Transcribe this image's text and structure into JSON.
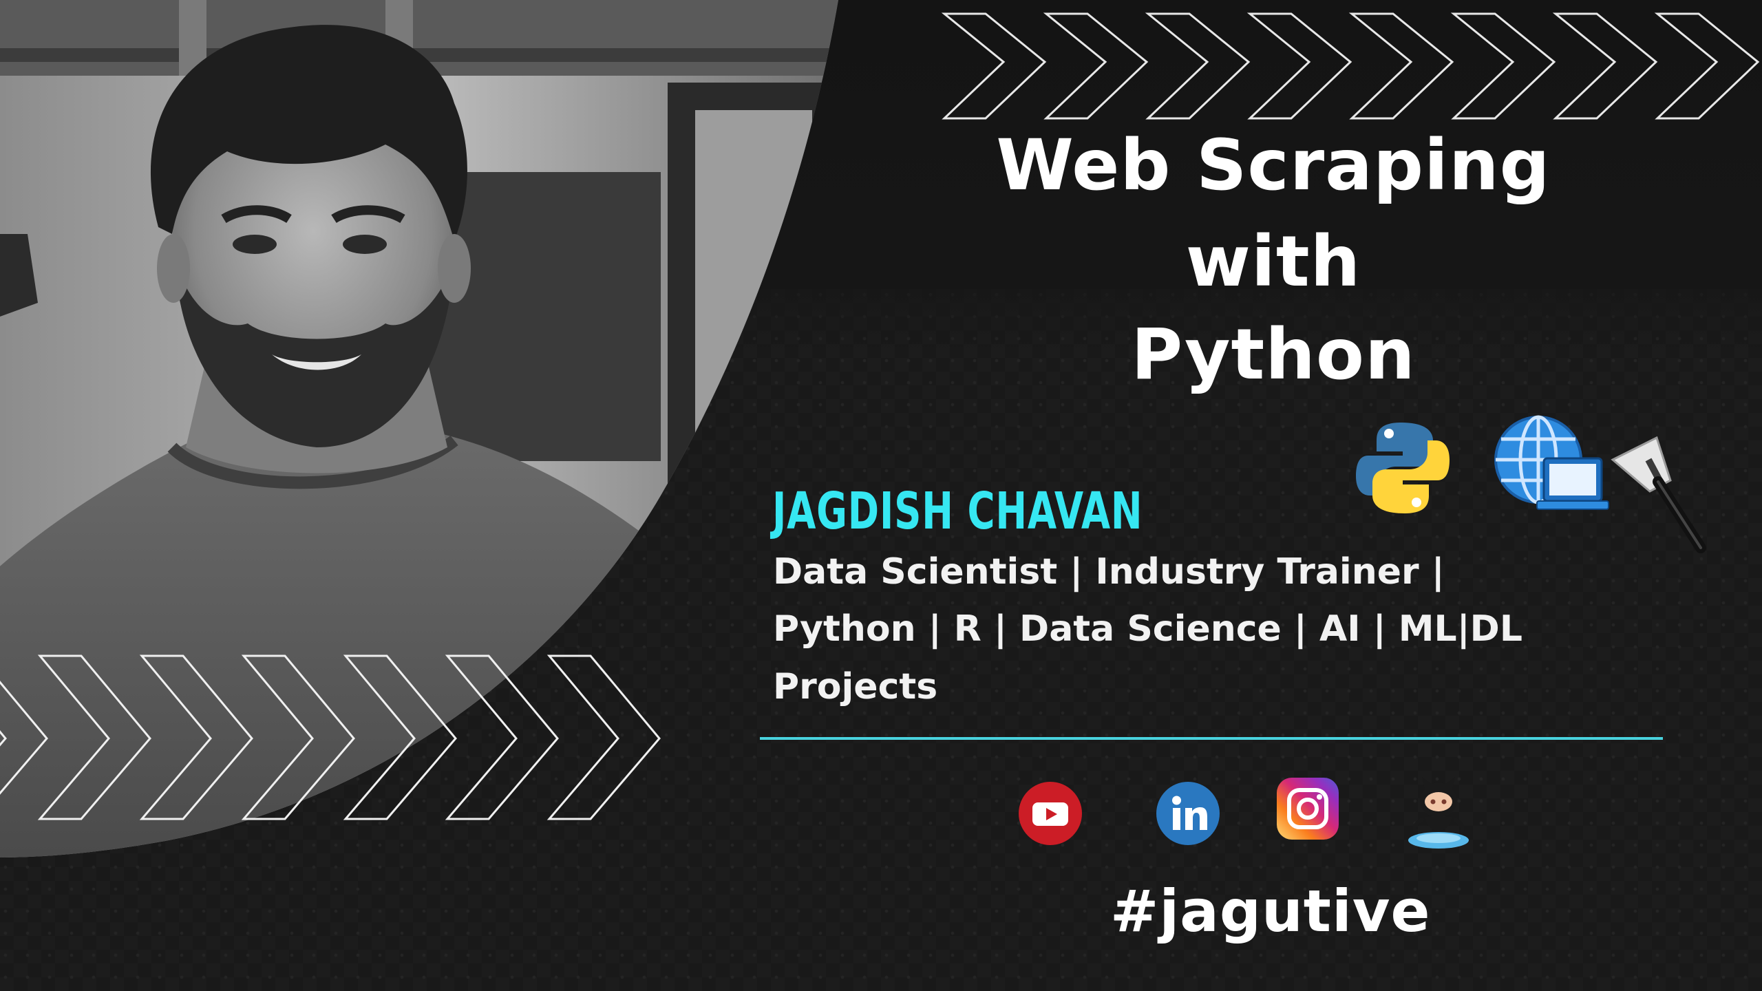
{
  "title": {
    "line1": "Web Scraping",
    "line2": "with",
    "line3": "Python"
  },
  "presenter": {
    "name": "JAGDISH CHAVAN",
    "tagline_line1": "Data Scientist | Industry Trainer |",
    "tagline_line2": "Python | R | Data Science | AI | ML|DL",
    "tagline_line3": "Projects"
  },
  "icons": {
    "topic": [
      "python-logo",
      "globe-computer-icon",
      "scraper-spatula-icon"
    ],
    "social": [
      "youtube-icon",
      "linkedin-icon",
      "instagram-icon",
      "github-octocat-icon"
    ]
  },
  "hashtag": "#jagutive",
  "colors": {
    "background": "#161616",
    "accent_cyan": "#36e7f2",
    "title_white": "#ffffff",
    "divider": "#49d3de"
  }
}
